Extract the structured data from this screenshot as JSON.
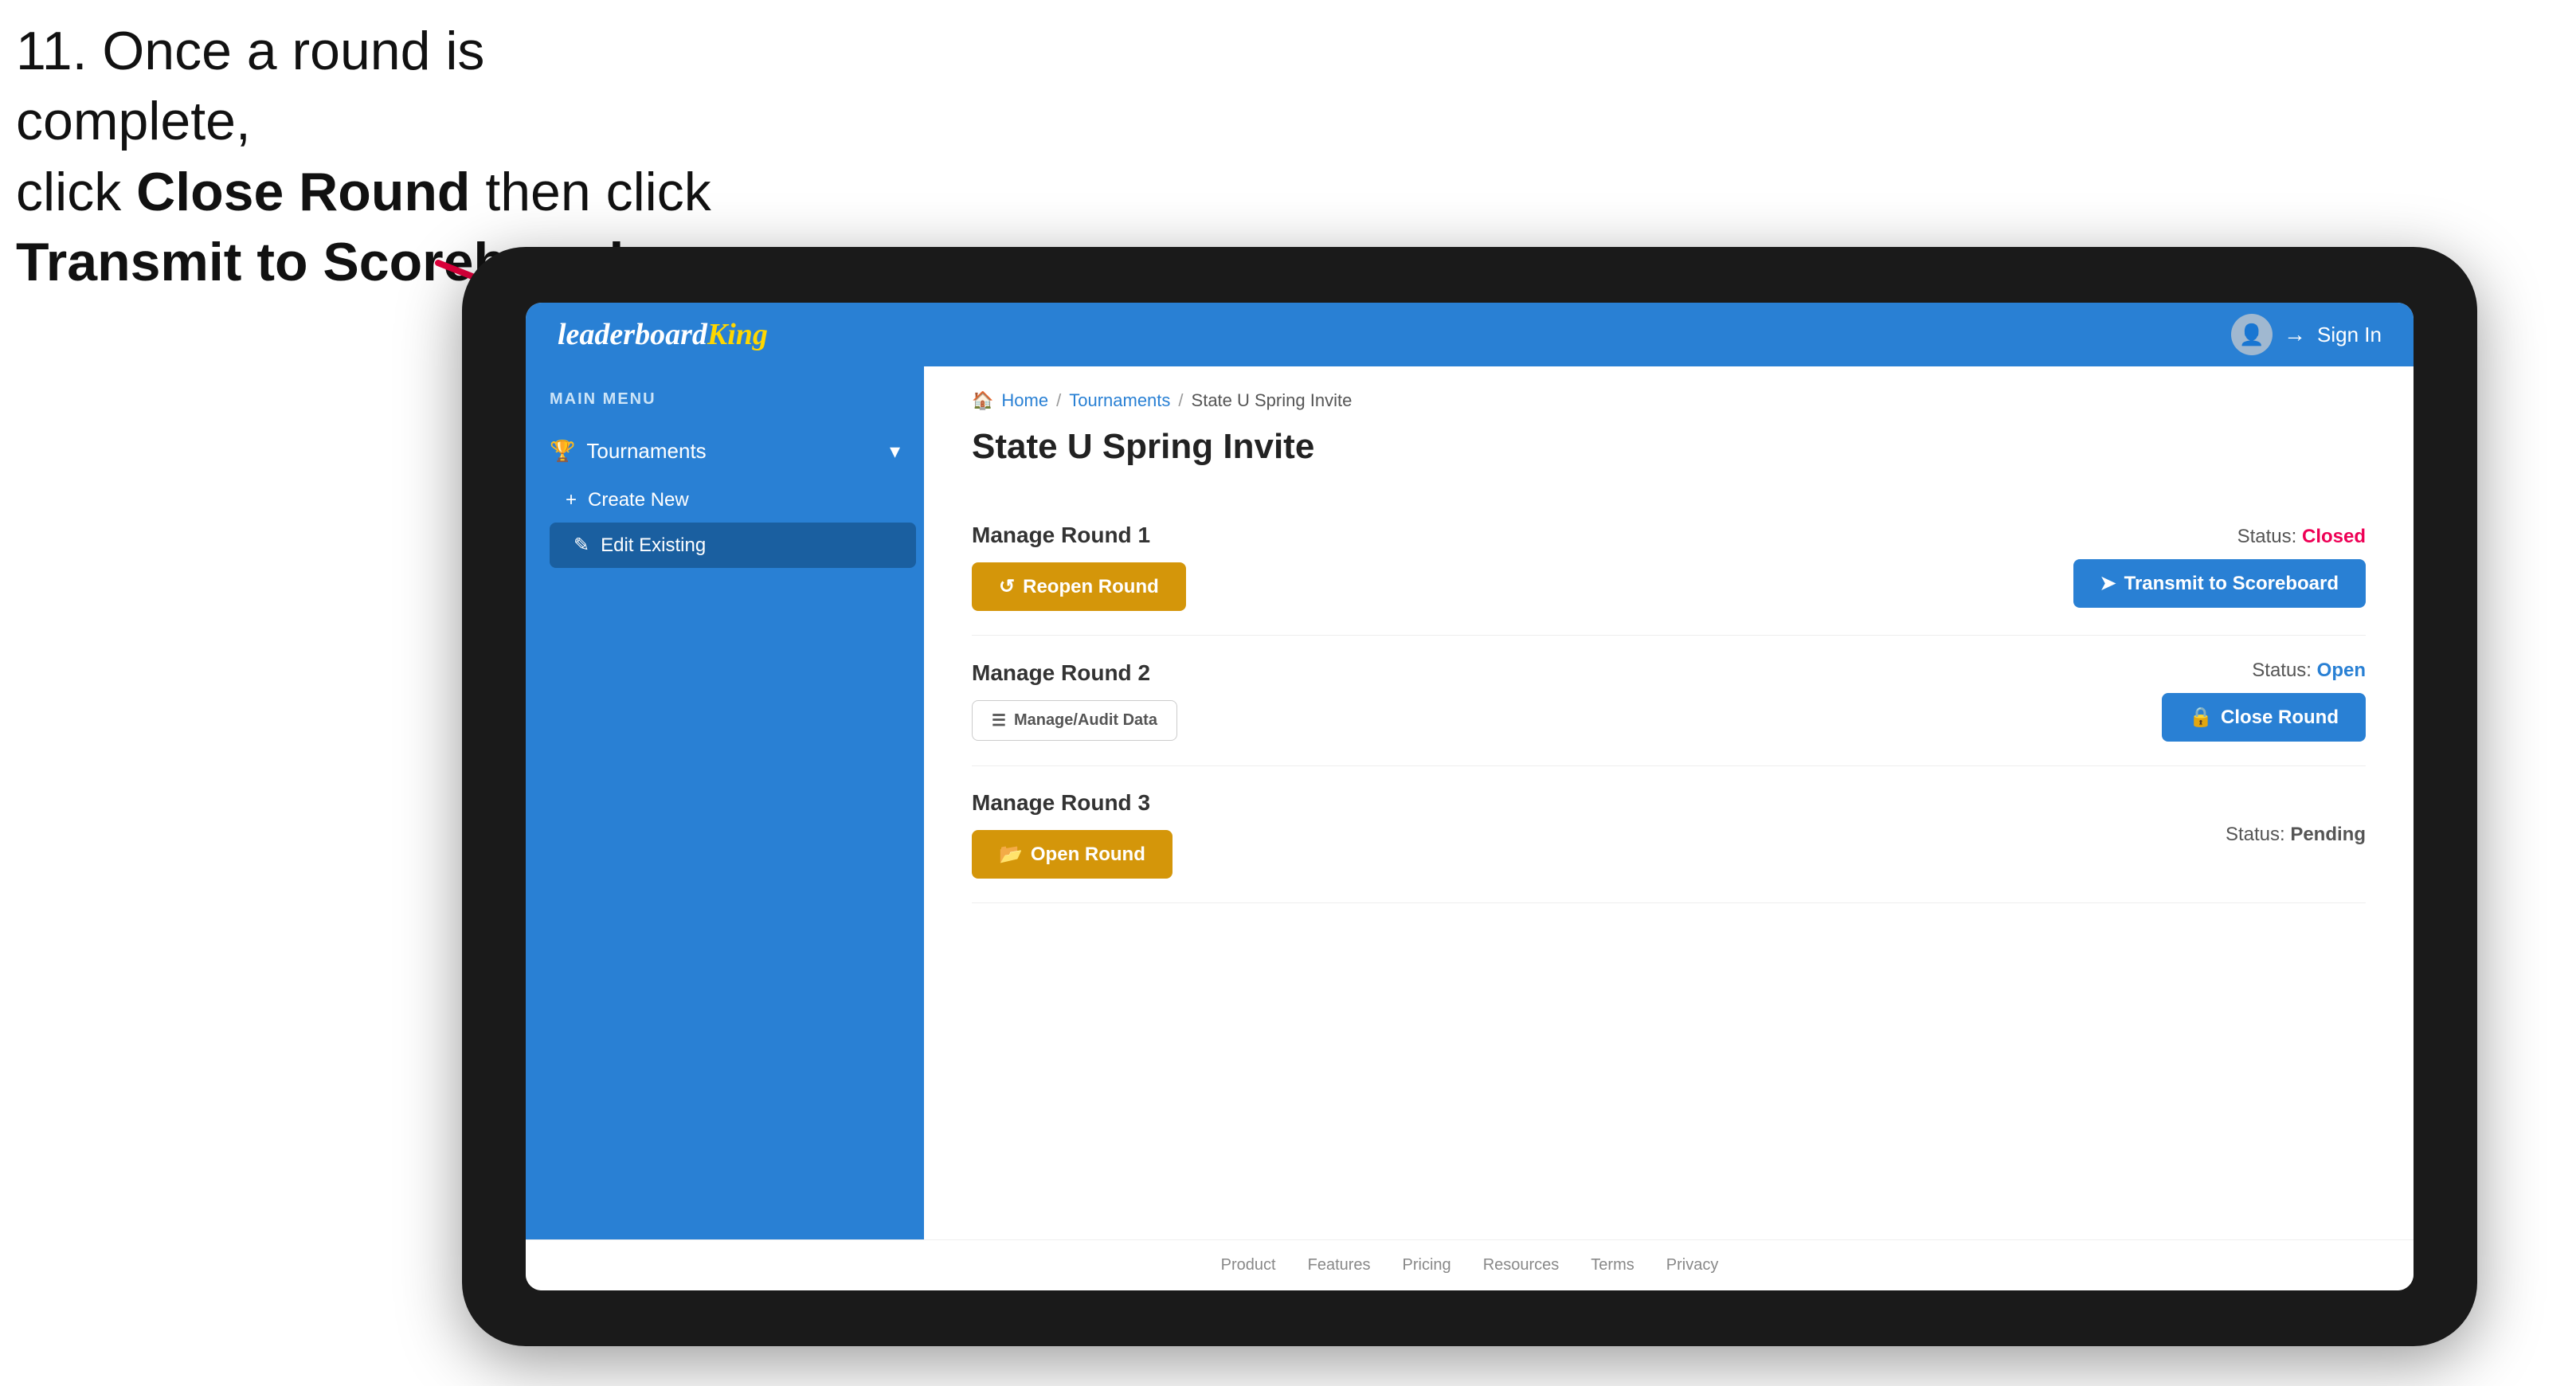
{
  "instruction": {
    "line1": "11. Once a round is complete,",
    "line2": "click ",
    "bold1": "Close Round",
    "line3": " then click",
    "bold2": "Transmit to Scoreboard."
  },
  "topbar": {
    "logo_plain": "leaderboard",
    "logo_styled": "King",
    "signin_label": "Sign In"
  },
  "sidebar": {
    "main_menu_label": "MAIN MENU",
    "tournaments_label": "Tournaments",
    "create_new_label": "Create New",
    "edit_existing_label": "Edit Existing"
  },
  "breadcrumb": {
    "home": "Home",
    "separator1": "/",
    "tournaments": "Tournaments",
    "separator2": "/",
    "current": "State U Spring Invite"
  },
  "page_title": "State U Spring Invite",
  "rounds": [
    {
      "id": "round1",
      "title": "Manage Round 1",
      "status_label": "Status:",
      "status_value": "Closed",
      "status_class": "status-closed",
      "primary_button": "Reopen Round",
      "primary_button_style": "btn-amber",
      "secondary_button": "Transmit to Scoreboard",
      "secondary_button_style": "btn-blue"
    },
    {
      "id": "round2",
      "title": "Manage Round 2",
      "status_label": "Status:",
      "status_value": "Open",
      "status_class": "status-open",
      "primary_button": "Manage/Audit Data",
      "primary_button_style": "btn-gray-outline",
      "secondary_button": "Close Round",
      "secondary_button_style": "btn-blue"
    },
    {
      "id": "round3",
      "title": "Manage Round 3",
      "status_label": "Status:",
      "status_value": "Pending",
      "status_class": "status-pending",
      "primary_button": "Open Round",
      "primary_button_style": "btn-amber",
      "secondary_button": null
    }
  ],
  "footer": {
    "links": [
      "Product",
      "Features",
      "Pricing",
      "Resources",
      "Terms",
      "Privacy"
    ]
  },
  "icons": {
    "trophy": "🏆",
    "plus": "+",
    "edit": "✎",
    "chevron_down": "▾",
    "reopen": "↺",
    "transmit": "➤",
    "manage": "☰",
    "close": "🔒",
    "open": "📂",
    "user": "👤",
    "signin_arrow": "→"
  }
}
